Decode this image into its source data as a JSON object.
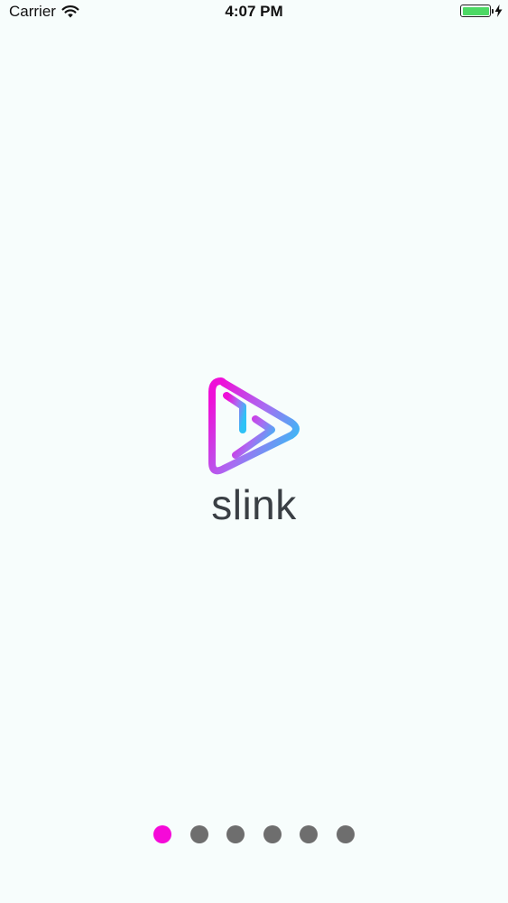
{
  "status_bar": {
    "carrier": "Carrier",
    "time": "4:07 PM",
    "battery_level": 1.0,
    "charging": true,
    "colors": {
      "battery_fill": "#4cd964"
    }
  },
  "logo": {
    "icon": "slink-play-triangle-logo",
    "brand_name": "slink",
    "colors": {
      "gradient_start": "#ee10d8",
      "gradient_end": "#2ec2f6",
      "text": "#3a3f44"
    }
  },
  "page_control": {
    "count": 6,
    "current_page": 1,
    "colors": {
      "active": "#f50ad8",
      "inactive": "#6e6e6e"
    }
  }
}
